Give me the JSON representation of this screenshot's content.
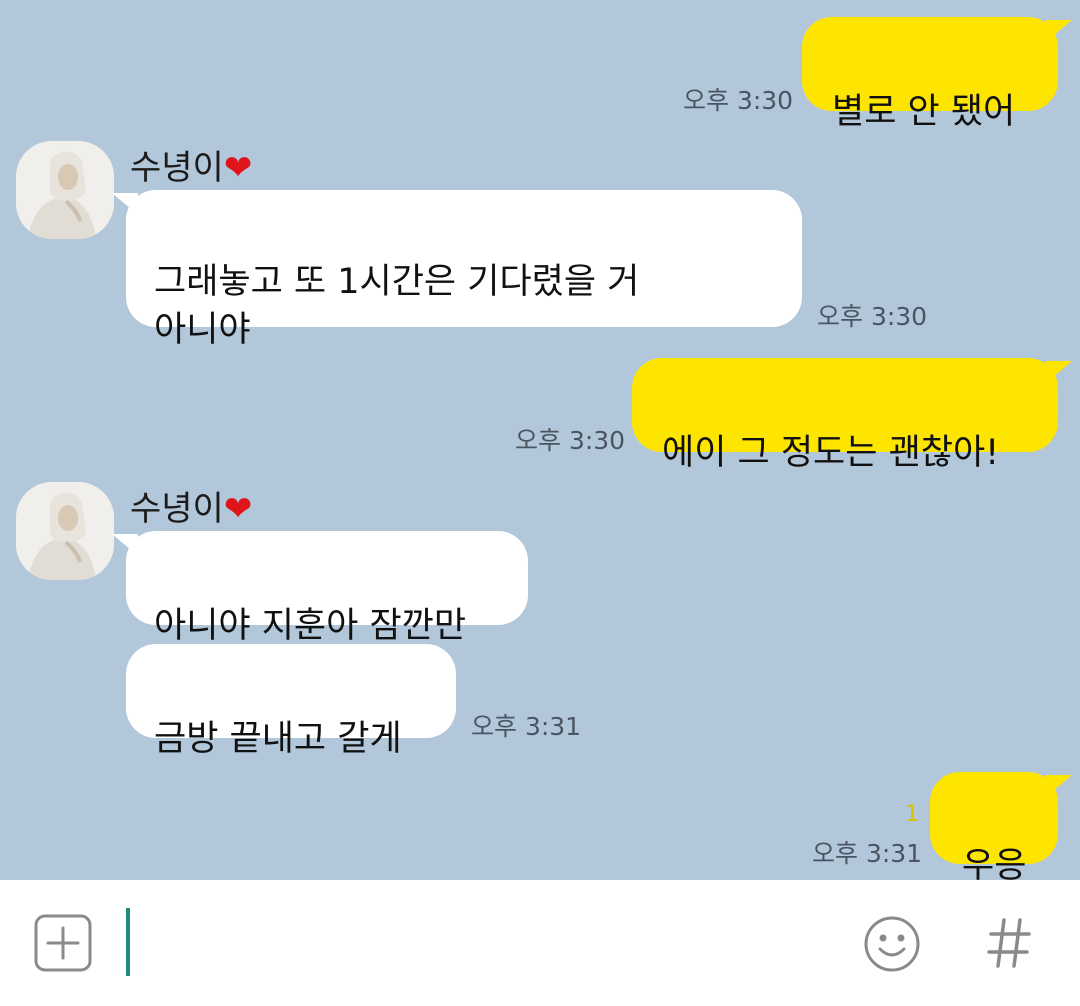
{
  "messages": [
    {
      "side": "mine",
      "text": "별로 안 됐어",
      "time": "오후 3:30"
    },
    {
      "side": "theirs",
      "sender": "수녕이",
      "text": "그래놓고 또 1시간은 기다렸을 거\n아니야",
      "time": "오후 3:30"
    },
    {
      "side": "mine",
      "text": "에이 그 정도는 괜찮아!",
      "time": "오후 3:30"
    },
    {
      "side": "theirs",
      "sender": "수녕이",
      "text": "아니야 지훈아 잠깐만"
    },
    {
      "side": "theirs",
      "text": "금방 끝내고 갈게",
      "time": "오후 3:31"
    },
    {
      "side": "mine",
      "text": "우응",
      "time": "오후 3:31",
      "unread": "1"
    }
  ],
  "sender_heart": "❤",
  "input": {
    "value": ""
  },
  "icons": {
    "add": "plus-square-icon",
    "emoji": "smiley-icon",
    "hash": "hash-icon"
  },
  "colors": {
    "background": "#b2c7da",
    "my_bubble": "#fee500",
    "their_bubble": "#ffffff",
    "cursor": "#1f8b7c"
  }
}
